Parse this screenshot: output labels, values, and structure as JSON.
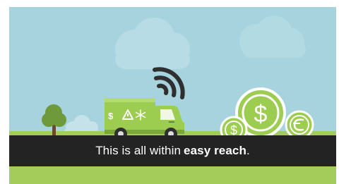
{
  "caption": {
    "text_before": "This is all within",
    "text_bold": "easy reach",
    "text_after": "."
  },
  "truck_symbols": {
    "dollar": "$"
  },
  "coins": {
    "large": "$",
    "small_left": "$"
  },
  "colors": {
    "sky": "#a6d3de",
    "grass": "#a3cc5b",
    "truck": "#9ccc50",
    "caption_bar": "#232323",
    "icon_dark": "#2f2f2f"
  }
}
